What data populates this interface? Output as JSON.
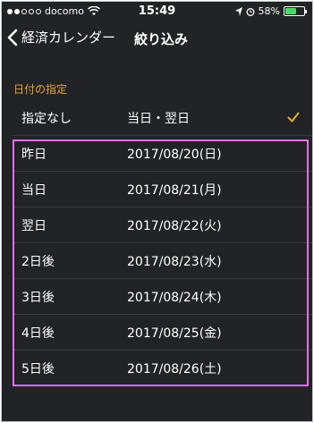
{
  "status_bar": {
    "carrier": "docomo",
    "time": "15:49",
    "battery": "58%",
    "battery_level": 0.58
  },
  "nav": {
    "back_label": "経済カレンダー",
    "title": "絞り込み"
  },
  "section": {
    "header": "日付の指定"
  },
  "rows": [
    {
      "label": "指定なし",
      "value": "当日・翌日",
      "checked": true
    },
    {
      "label": "昨日",
      "value": "2017/08/20(日)"
    },
    {
      "label": "当日",
      "value": "2017/08/21(月)"
    },
    {
      "label": "翌日",
      "value": "2017/08/22(火)"
    },
    {
      "label": "2日後",
      "value": "2017/08/23(水)"
    },
    {
      "label": "3日後",
      "value": "2017/08/24(木)"
    },
    {
      "label": "4日後",
      "value": "2017/08/25(金)"
    },
    {
      "label": "5日後",
      "value": "2017/08/26(土)"
    }
  ],
  "colors": {
    "background": "#212327",
    "accent": "#e6a72e",
    "highlight": "#ea6cf2"
  }
}
